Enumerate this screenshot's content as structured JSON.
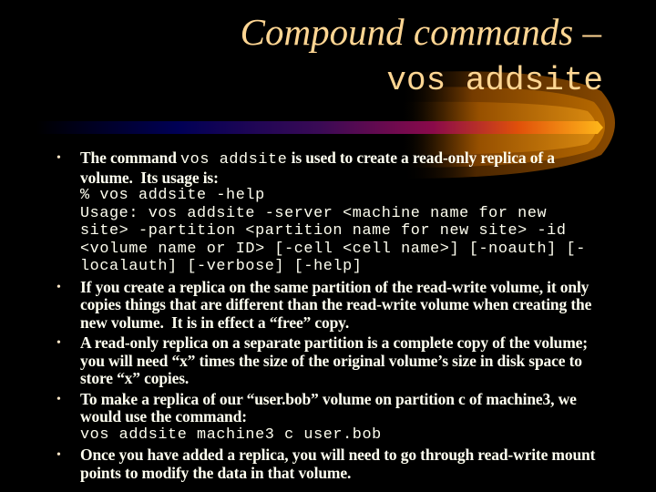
{
  "title": {
    "line1": "Compound commands –",
    "line2": "vos addsite"
  },
  "colors": {
    "background": "#000000",
    "title": "#FFD693",
    "body_text": "#FFFFF0",
    "bar_start": "#000033",
    "bar_mid": "#8B0A4A",
    "bar_end": "#FFB81A",
    "swoosh": "#B86A00"
  },
  "bullets": [
    {
      "lines": [
        {
          "parts": [
            {
              "text": "The command ",
              "mono": false
            },
            {
              "text": "vos addsite",
              "mono": true
            },
            {
              "text": " is used to create a read-only replica of a",
              "mono": false
            }
          ]
        },
        {
          "parts": [
            {
              "text": "volume.  Its usage is:",
              "mono": false
            }
          ]
        },
        {
          "parts": [
            {
              "text": "% vos addsite -help",
              "mono": true
            }
          ]
        },
        {
          "parts": [
            {
              "text": "Usage: vos addsite -server <machine name for new",
              "mono": true
            }
          ]
        },
        {
          "parts": [
            {
              "text": "site> -partition <partition name for new site> -id",
              "mono": true
            }
          ]
        },
        {
          "parts": [
            {
              "text": "<volume name or ID> [-cell <cell name>] [-noauth] [-",
              "mono": true
            }
          ]
        },
        {
          "parts": [
            {
              "text": "localauth] [-verbose] [-help]",
              "mono": true
            }
          ]
        }
      ]
    },
    {
      "lines": [
        {
          "parts": [
            {
              "text": "If you create a replica on the same partition of the read-write volume, it only",
              "mono": false
            }
          ]
        },
        {
          "parts": [
            {
              "text": "copies things that are different than the read-write volume when creating the",
              "mono": false
            }
          ]
        },
        {
          "parts": [
            {
              "text": "new volume.  It is in effect a “free” copy.",
              "mono": false
            }
          ]
        }
      ]
    },
    {
      "lines": [
        {
          "parts": [
            {
              "text": "A read-only replica on a separate partition is a complete copy of the volume;",
              "mono": false
            }
          ]
        },
        {
          "parts": [
            {
              "text": "you will need “x” times the size of the original volume’s size in disk space to",
              "mono": false
            }
          ]
        },
        {
          "parts": [
            {
              "text": "store “x” copies.",
              "mono": false
            }
          ]
        }
      ]
    },
    {
      "lines": [
        {
          "parts": [
            {
              "text": "To make a replica of our “user.bob” volume on partition c of machine3, we",
              "mono": false
            }
          ]
        },
        {
          "parts": [
            {
              "text": "would use the command:",
              "mono": false
            }
          ]
        },
        {
          "parts": [
            {
              "text": "vos addsite machine3 c user.bob",
              "mono": true
            }
          ]
        }
      ]
    },
    {
      "lines": [
        {
          "parts": [
            {
              "text": "Once you have added a replica, you will need to go through read-write mount",
              "mono": false
            }
          ]
        },
        {
          "parts": [
            {
              "text": "points to modify the data in that volume.",
              "mono": false
            }
          ]
        }
      ]
    }
  ],
  "bullet_glyph": "•",
  "icons": {
    "decoration": "comet-swoosh-bar"
  }
}
